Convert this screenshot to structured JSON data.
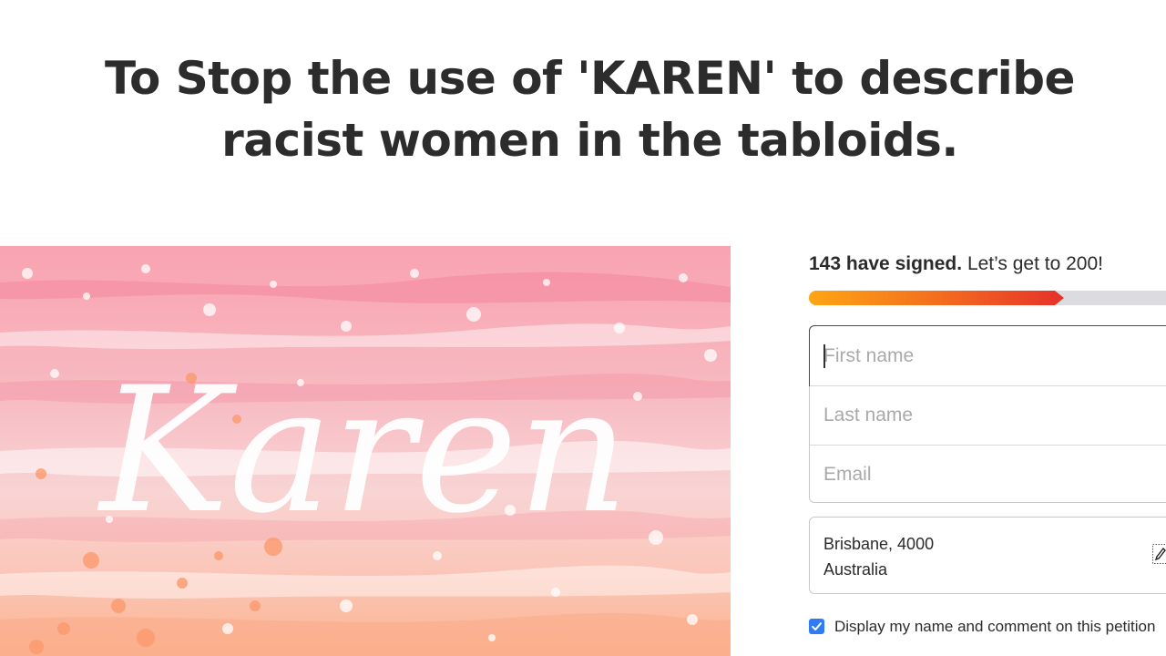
{
  "petition": {
    "title": "To Stop the use of 'KAREN' to describe racist women in the tabloids."
  },
  "hero_image": {
    "text": "Karen",
    "description_colors": [
      "#f7a7b3",
      "#fbd3cf",
      "#fbb58f",
      "#ffffff"
    ]
  },
  "signatures": {
    "count_text": "143 have signed.",
    "goal_text": "Let’s get to 200!",
    "signed": 143,
    "goal": 200,
    "progress_fraction": 0.715,
    "colors": {
      "fill_start": "#fea514",
      "fill_end": "#e6312a",
      "track": "#dcdbe0"
    }
  },
  "form": {
    "first_name_placeholder": "First name",
    "last_name_placeholder": "Last name",
    "email_placeholder": "Email",
    "location": {
      "city": "Brisbane, 4000",
      "country": "Australia",
      "edit_icon": "pencil-icon"
    },
    "display_checkbox": {
      "checked": true,
      "label": "Display my name and comment on this petition"
    }
  }
}
